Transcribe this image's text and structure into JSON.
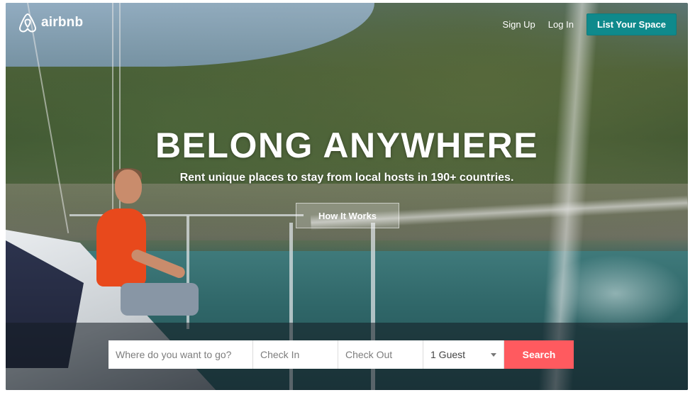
{
  "brand": {
    "logo_text": "airbnb"
  },
  "nav": {
    "sign_up": "Sign Up",
    "log_in": "Log In",
    "list_space": "List Your Space"
  },
  "hero": {
    "headline": "BELONG ANYWHERE",
    "subheadline": "Rent unique places to stay from local hosts in 190+ countries.",
    "how_it_works": "How It Works"
  },
  "search": {
    "where_placeholder": "Where do you want to go?",
    "check_in_placeholder": "Check In",
    "check_out_placeholder": "Check Out",
    "guests_value": "1 Guest",
    "search_label": "Search"
  },
  "colors": {
    "accent": "#ff5a5f",
    "teal": "#0f8a8c"
  },
  "icons": {
    "logo": "airbnb-belo-icon",
    "dropdown": "chevron-down-icon"
  }
}
